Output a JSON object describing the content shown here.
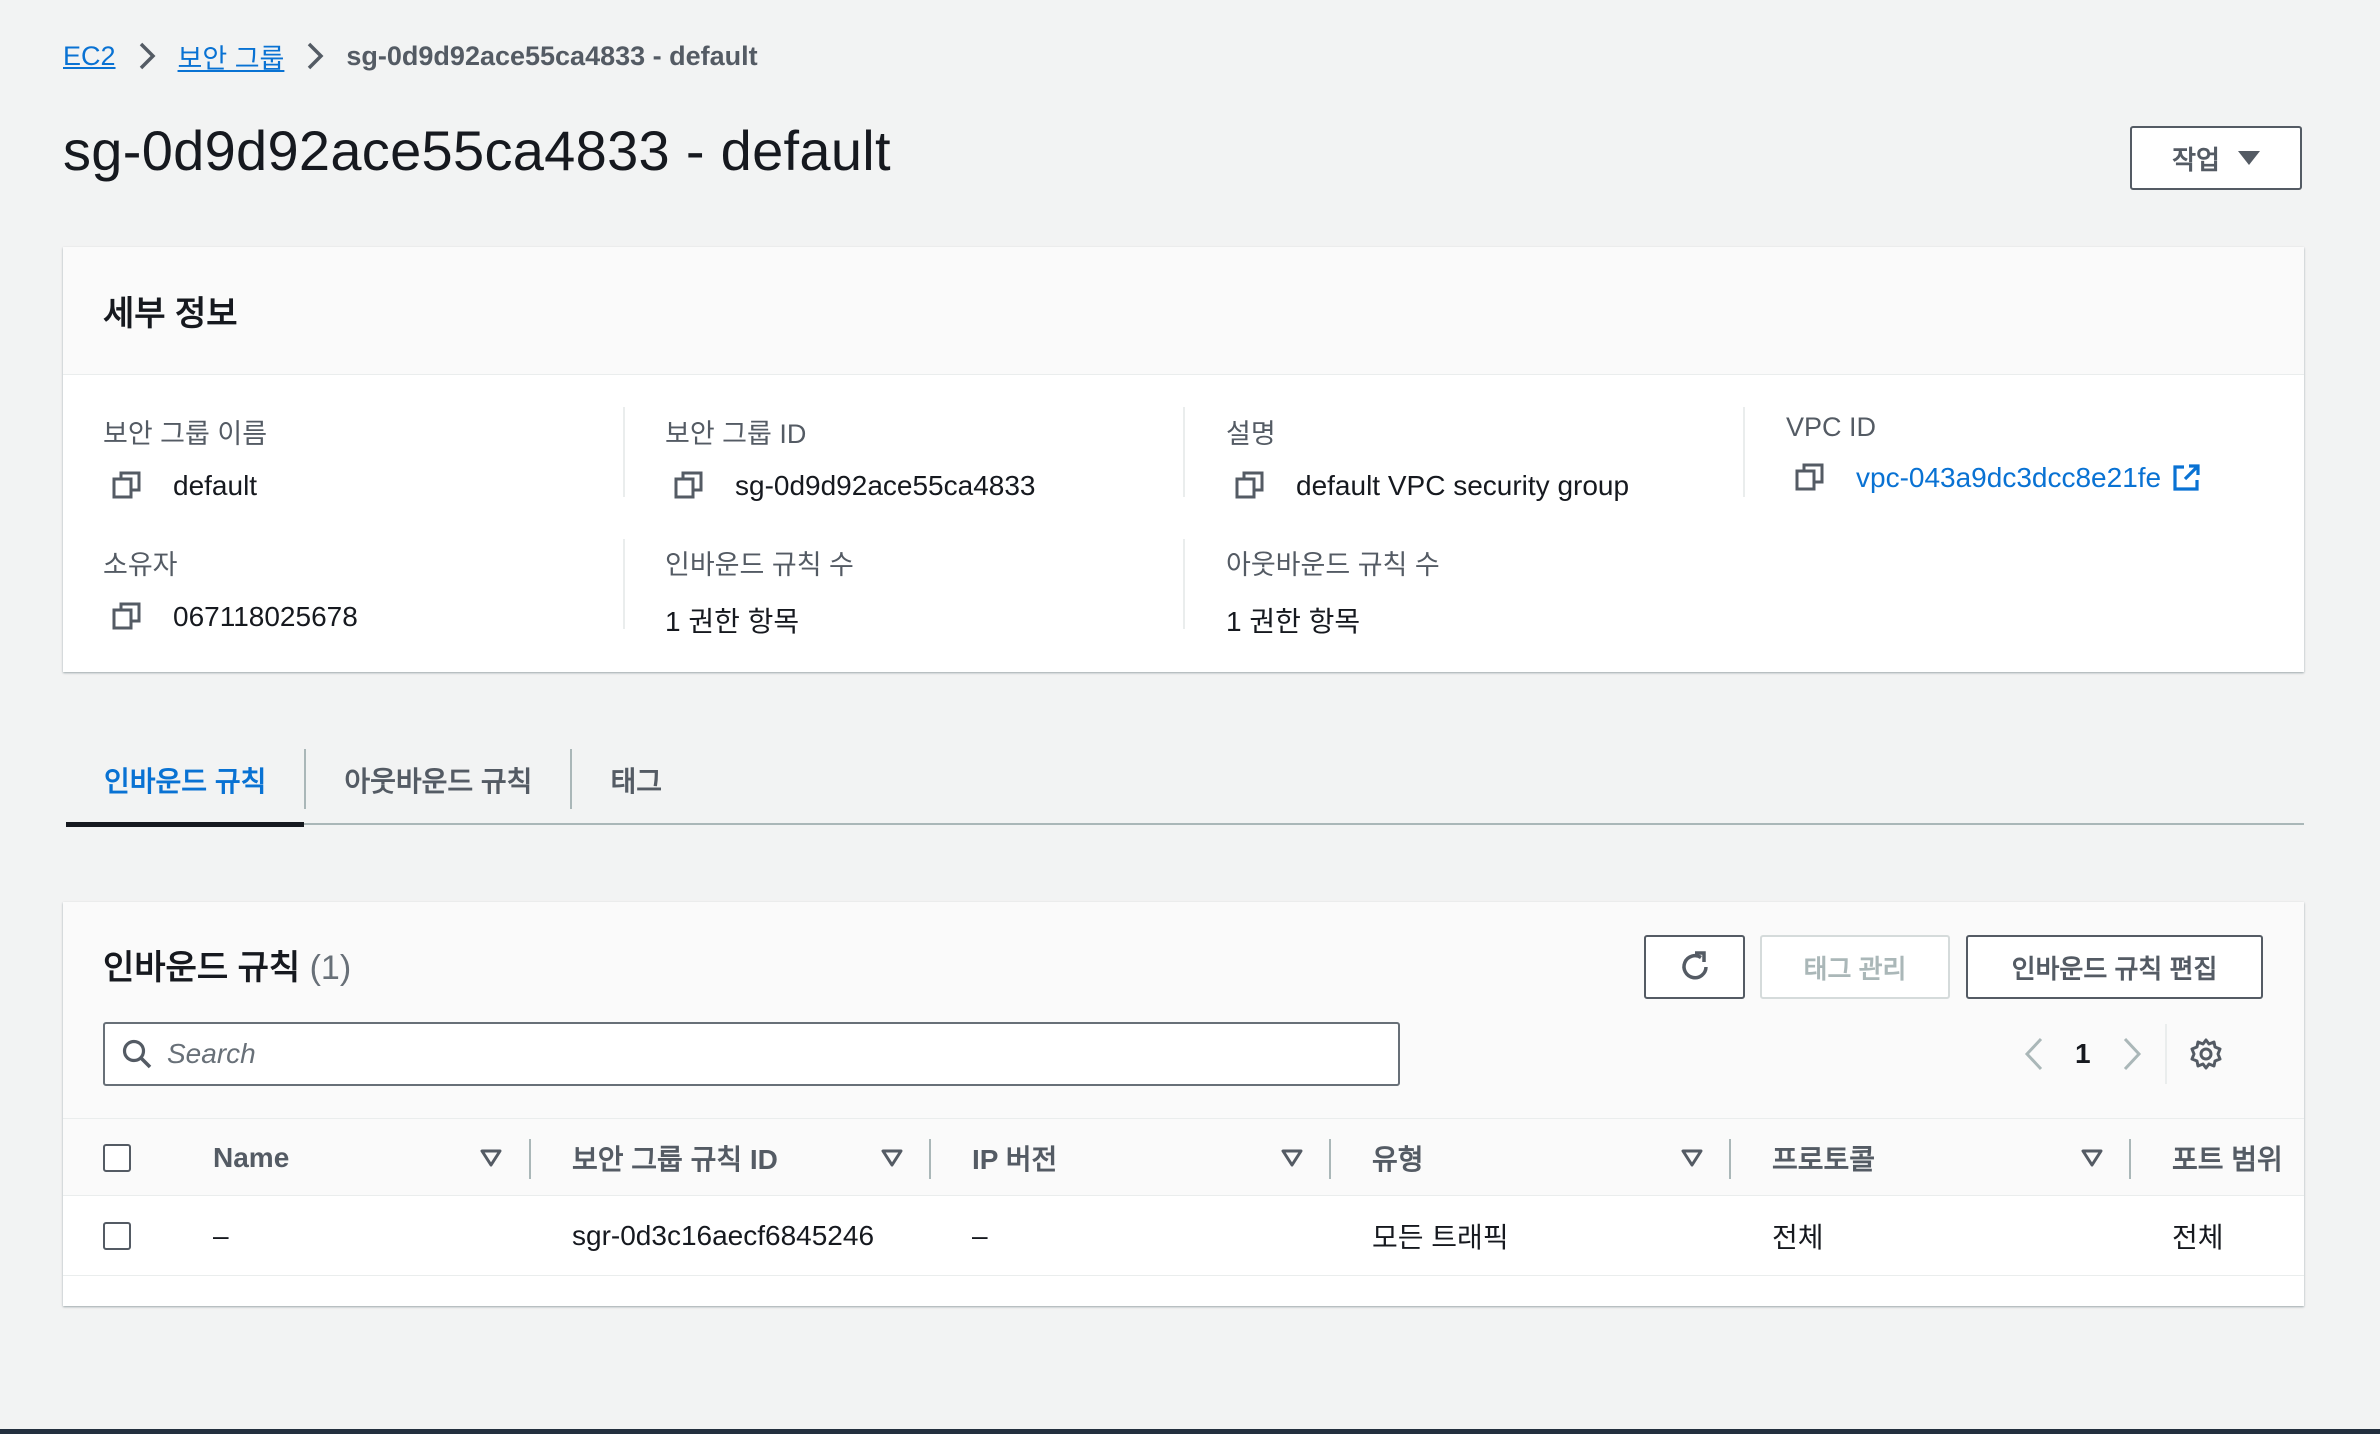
{
  "breadcrumb": {
    "items": [
      "EC2",
      "보안 그룹"
    ],
    "current": "sg-0d9d92ace55ca4833 - default"
  },
  "page": {
    "title": "sg-0d9d92ace55ca4833 - default",
    "actions_label": "작업"
  },
  "details": {
    "heading": "세부 정보",
    "fields": {
      "group_name": {
        "label": "보안 그룹 이름",
        "value": "default"
      },
      "group_id": {
        "label": "보안 그룹 ID",
        "value": "sg-0d9d92ace55ca4833"
      },
      "description": {
        "label": "설명",
        "value": "default VPC security group"
      },
      "vpc_id": {
        "label": "VPC ID",
        "value": "vpc-043a9dc3dcc8e21fe"
      },
      "owner": {
        "label": "소유자",
        "value": "067118025678"
      },
      "inbound_count": {
        "label": "인바운드 규칙 수",
        "value": "1 권한 항목"
      },
      "outbound_count": {
        "label": "아웃바운드 규칙 수",
        "value": "1 권한 항목"
      }
    }
  },
  "tabs": [
    {
      "label": "인바운드 규칙",
      "active": true
    },
    {
      "label": "아웃바운드 규칙",
      "active": false
    },
    {
      "label": "태그",
      "active": false
    }
  ],
  "rules": {
    "title": "인바운드 규칙",
    "count": "(1)",
    "manage_tags_label": "태그 관리",
    "edit_label": "인바운드 규칙 편집",
    "search_placeholder": "Search",
    "page_number": "1",
    "columns": [
      "Name",
      "보안 그룹 규칙 ID",
      "IP 버전",
      "유형",
      "프로토콜",
      "포트 범위"
    ],
    "rows": [
      [
        "–",
        "sgr-0d3c16aecf6845246",
        "–",
        "모든 트래픽",
        "전체",
        "전체"
      ]
    ]
  },
  "colors": {
    "link": "#0972d3",
    "text": "#16191f",
    "muted": "#545b64",
    "background": "#f2f3f3"
  }
}
